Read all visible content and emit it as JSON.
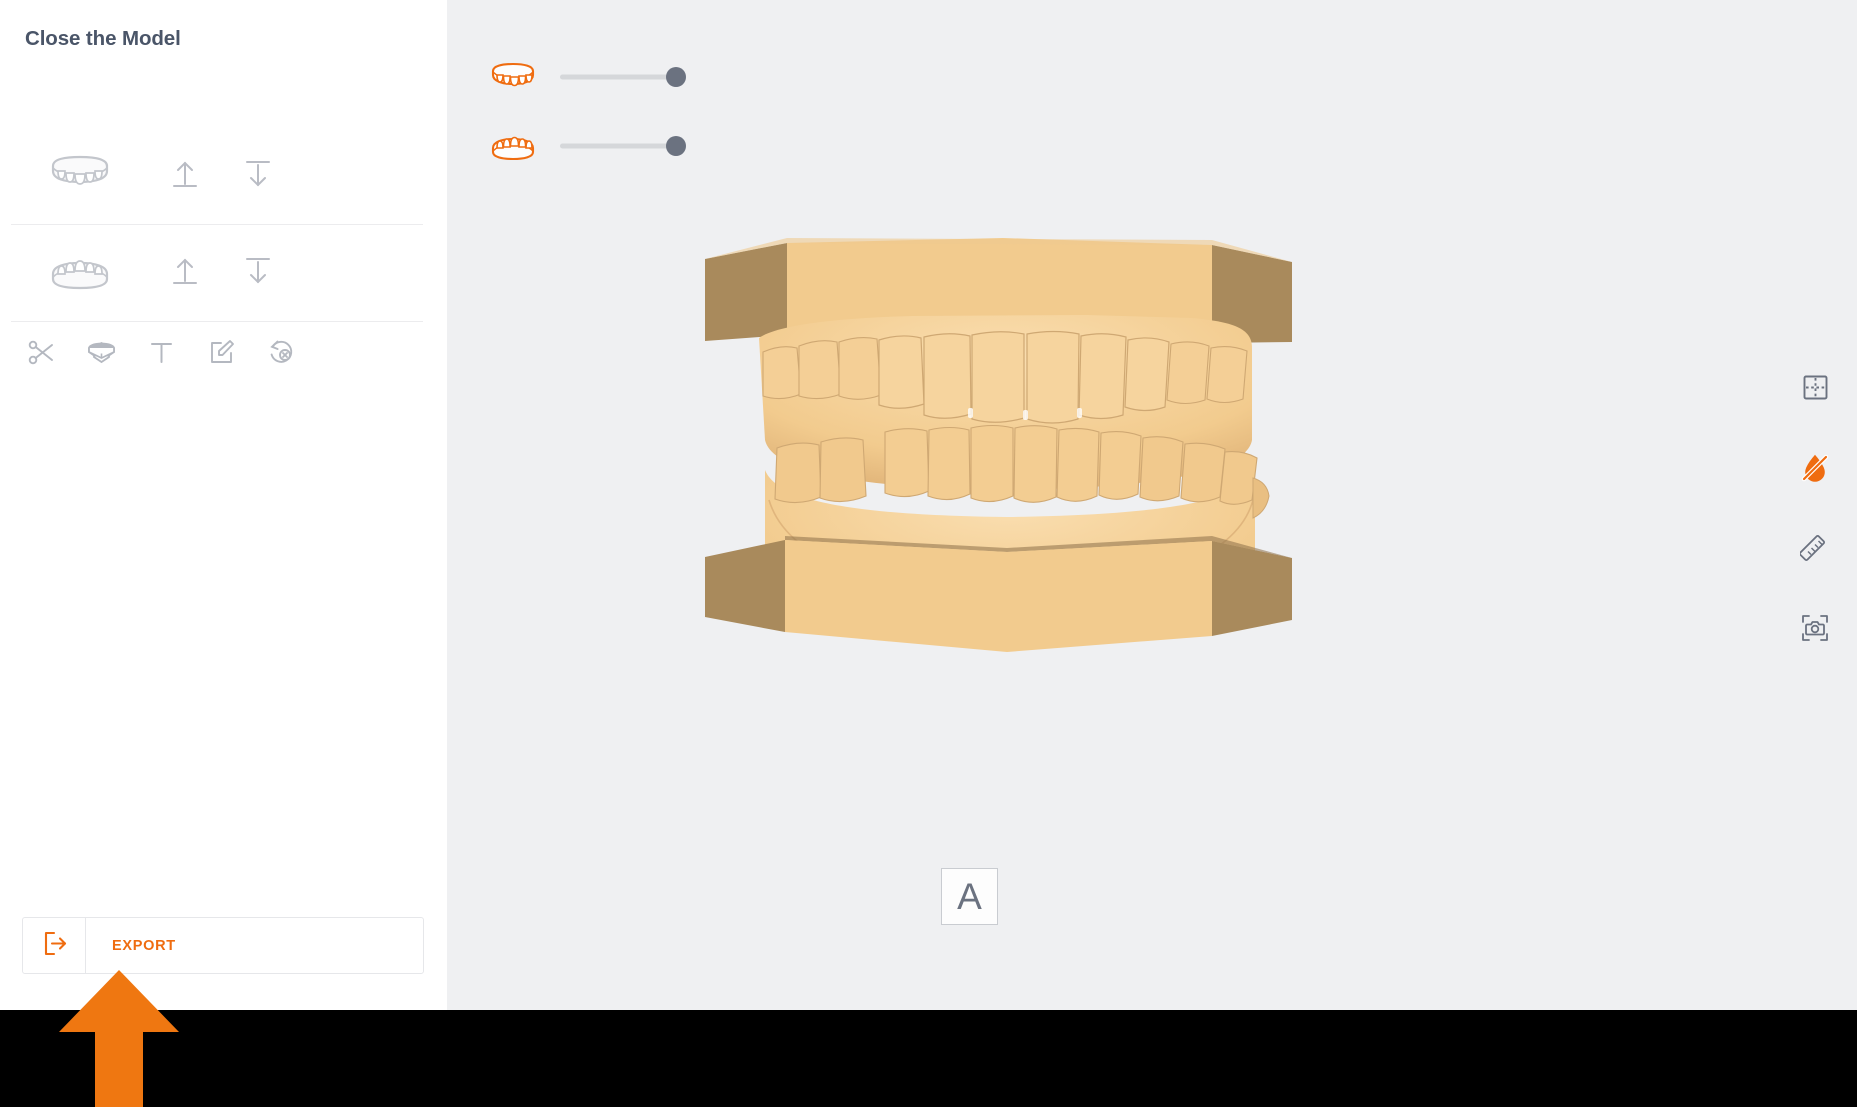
{
  "app": {
    "accent_color": "#ef6c10",
    "sidebar_bg": "#ffffff",
    "viewport_bg": "#eff0f2",
    "model_front_color": "#f2cb8e",
    "model_side_color": "#a98a5c",
    "tooth_color": "#f4cf96"
  },
  "sidebar": {
    "title": "Close the Model",
    "arch_rows": [
      {
        "arch_icon": "upper-arch-icon",
        "arch_label": "Upper Arch",
        "up_icon": "arrow-up-from-line-icon",
        "up_label": "Move Upper Arch Up",
        "down_icon": "arrow-down-from-line-icon",
        "down_label": "Move Upper Arch Down"
      },
      {
        "arch_icon": "lower-arch-icon",
        "arch_label": "Lower Arch",
        "up_icon": "arrow-up-from-line-icon",
        "up_label": "Move Lower Arch Up",
        "down_icon": "arrow-down-from-line-icon",
        "down_label": "Move Lower Arch Down"
      }
    ],
    "tools": [
      {
        "icon": "scissors-icon",
        "label": "Cut"
      },
      {
        "icon": "model-base-icon",
        "label": "Base"
      },
      {
        "icon": "text-icon",
        "label": "Text"
      },
      {
        "icon": "edit-square-icon",
        "label": "Edit"
      },
      {
        "icon": "undo-reset-icon",
        "label": "Reset"
      }
    ],
    "export": {
      "icon": "export-icon",
      "label": "EXPORT"
    }
  },
  "viewport": {
    "sliders": [
      {
        "icon": "upper-arch-slider-icon",
        "label": "Upper Arch Opacity",
        "value": 100,
        "min": 0,
        "max": 100
      },
      {
        "icon": "lower-arch-slider-icon",
        "label": "Lower Arch Opacity",
        "value": 100,
        "min": 0,
        "max": 100
      }
    ],
    "right_tools": [
      {
        "icon": "grid-split-view-icon",
        "label": "Split View",
        "active": false
      },
      {
        "icon": "occlusion-off-icon",
        "label": "Occlusion Off",
        "active": true
      },
      {
        "icon": "ruler-measure-icon",
        "label": "Measure",
        "active": false
      },
      {
        "icon": "camera-capture-icon",
        "label": "Screenshot",
        "active": false
      }
    ],
    "annotation": {
      "icon": "text-annotation-box",
      "label": "A"
    },
    "model": {
      "label": "Orthodontic Study Model",
      "upper_base_label": "Upper Base",
      "lower_base_label": "Lower Base",
      "dentition_label": "Dentition"
    }
  },
  "callout": {
    "icon": "orange-up-arrow-annotation",
    "label": "Points to Export button"
  }
}
